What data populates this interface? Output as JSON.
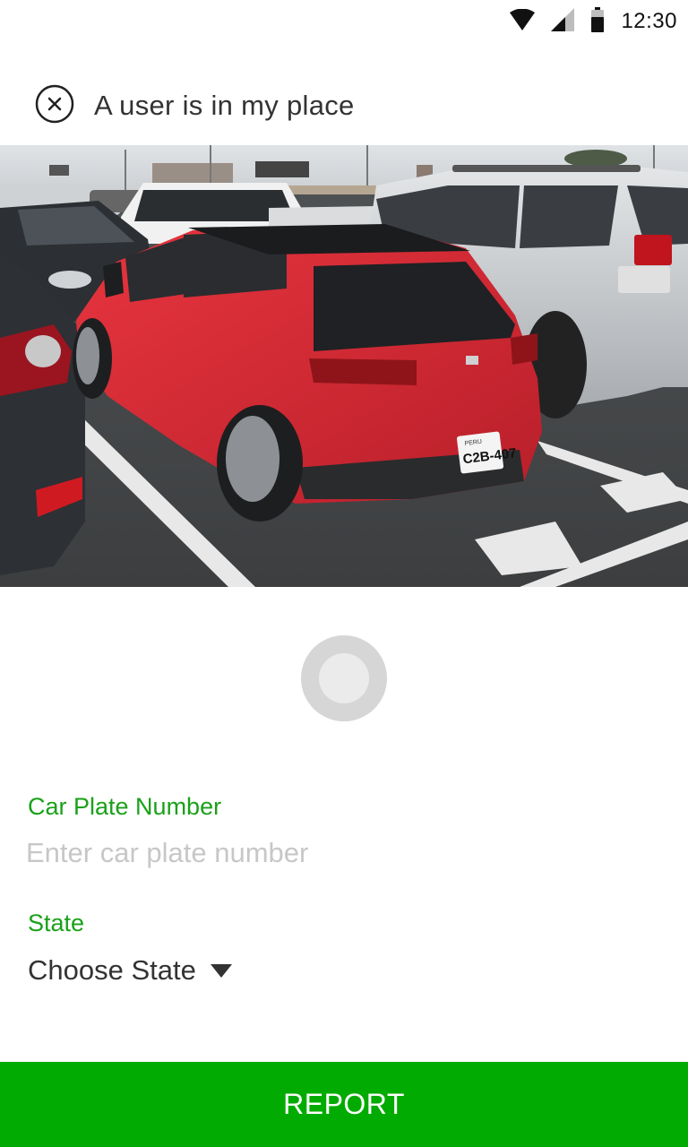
{
  "status_bar": {
    "time": "12:30",
    "icons": [
      "wifi-icon",
      "cell-signal-icon",
      "battery-icon"
    ]
  },
  "header": {
    "title": "A user is in my place",
    "close_icon": "close-circle-icon"
  },
  "photo": {
    "plate_text": "C2B-407",
    "plate_region": "PERU"
  },
  "form": {
    "plate": {
      "label": "Car Plate Number",
      "placeholder": "Enter car plate number",
      "value": ""
    },
    "state": {
      "label": "State",
      "selected": "Choose State"
    }
  },
  "report_button": {
    "label": "REPORT"
  },
  "colors": {
    "accent": "#02ab02",
    "label_green": "#1aa11a",
    "text": "#333333",
    "placeholder": "#c7c7c7"
  }
}
